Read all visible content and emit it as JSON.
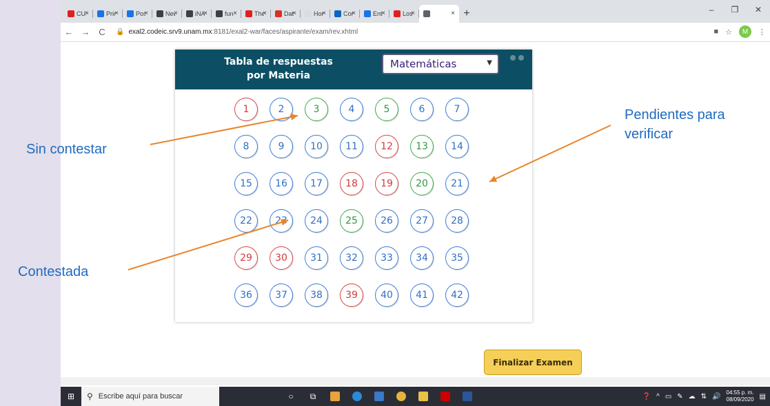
{
  "browser": {
    "tabs": [
      {
        "label": "CUR",
        "color": "#e02020"
      },
      {
        "label": "Prim",
        "color": "#1a73e8"
      },
      {
        "label": "Posa",
        "color": "#1a73e8"
      },
      {
        "label": "New",
        "color": "#3c4043"
      },
      {
        "label": "iNAC",
        "color": "#3c4043"
      },
      {
        "label": "fun",
        "color": "#3c4043"
      },
      {
        "label": "The",
        "color": "#e02020"
      },
      {
        "label": "Dat",
        "color": "#d93025"
      },
      {
        "label": "Hon",
        "color": "#dadce0"
      },
      {
        "label": "Corr",
        "color": "#0a66c2"
      },
      {
        "label": "Entr",
        "color": "#1a73e8"
      },
      {
        "label": "Los",
        "color": "#e02020"
      },
      {
        "label": "",
        "color": "#5f6368"
      }
    ],
    "tab_close": "×",
    "new_tab": "+",
    "window_controls": {
      "minimize": "–",
      "maximize": "❐",
      "close": "✕"
    },
    "nav": {
      "back": "←",
      "forward": "→",
      "reload": "C"
    },
    "url_host": "exal2.codeic.srv9.unam.mx",
    "url_path": ":8181/exal2-war/faces/aspirante/exam/rev.xhtml",
    "avatar_letter": "M"
  },
  "panel": {
    "title": "Tabla de respuestas\npor Materia",
    "subject_selected": "Matemáticas"
  },
  "questions": [
    {
      "n": "1",
      "status": "unanswered"
    },
    {
      "n": "2",
      "status": "answered"
    },
    {
      "n": "3",
      "status": "pending"
    },
    {
      "n": "4",
      "status": "answered"
    },
    {
      "n": "5",
      "status": "pending"
    },
    {
      "n": "6",
      "status": "answered"
    },
    {
      "n": "7",
      "status": "answered"
    },
    {
      "n": "8",
      "status": "answered"
    },
    {
      "n": "9",
      "status": "answered"
    },
    {
      "n": "10",
      "status": "answered"
    },
    {
      "n": "11",
      "status": "answered"
    },
    {
      "n": "12",
      "status": "unanswered"
    },
    {
      "n": "13",
      "status": "pending"
    },
    {
      "n": "14",
      "status": "answered"
    },
    {
      "n": "15",
      "status": "answered"
    },
    {
      "n": "16",
      "status": "answered"
    },
    {
      "n": "17",
      "status": "answered"
    },
    {
      "n": "18",
      "status": "unanswered"
    },
    {
      "n": "19",
      "status": "unanswered"
    },
    {
      "n": "20",
      "status": "pending"
    },
    {
      "n": "21",
      "status": "answered"
    },
    {
      "n": "22",
      "status": "answered"
    },
    {
      "n": "23",
      "status": "answered"
    },
    {
      "n": "24",
      "status": "answered"
    },
    {
      "n": "25",
      "status": "pending"
    },
    {
      "n": "26",
      "status": "answered"
    },
    {
      "n": "27",
      "status": "answered"
    },
    {
      "n": "28",
      "status": "answered"
    },
    {
      "n": "29",
      "status": "unanswered"
    },
    {
      "n": "30",
      "status": "unanswered"
    },
    {
      "n": "31",
      "status": "answered"
    },
    {
      "n": "32",
      "status": "answered"
    },
    {
      "n": "33",
      "status": "answered"
    },
    {
      "n": "34",
      "status": "answered"
    },
    {
      "n": "35",
      "status": "answered"
    },
    {
      "n": "36",
      "status": "answered"
    },
    {
      "n": "37",
      "status": "answered"
    },
    {
      "n": "38",
      "status": "answered"
    },
    {
      "n": "39",
      "status": "unanswered"
    },
    {
      "n": "40",
      "status": "answered"
    },
    {
      "n": "41",
      "status": "answered"
    },
    {
      "n": "42",
      "status": "answered"
    }
  ],
  "callouts": {
    "unanswered": "Sin contestar",
    "pending": "Pendientes para\nverificar",
    "answered": "Contestada"
  },
  "colors": {
    "header_bg": "#0c4f65",
    "answered": "#2f6fc4",
    "unanswered": "#d23a3a",
    "pending": "#2e9a3c",
    "callout_text": "#1f6ac0",
    "arrow": "#e8852a",
    "finish_button": "#f6cf58"
  },
  "finish_button": "Finalizar Examen",
  "taskbar": {
    "search_placeholder": "Escribe aquí para buscar",
    "time": "04:55 p. m.",
    "date": "08/09/2020"
  }
}
